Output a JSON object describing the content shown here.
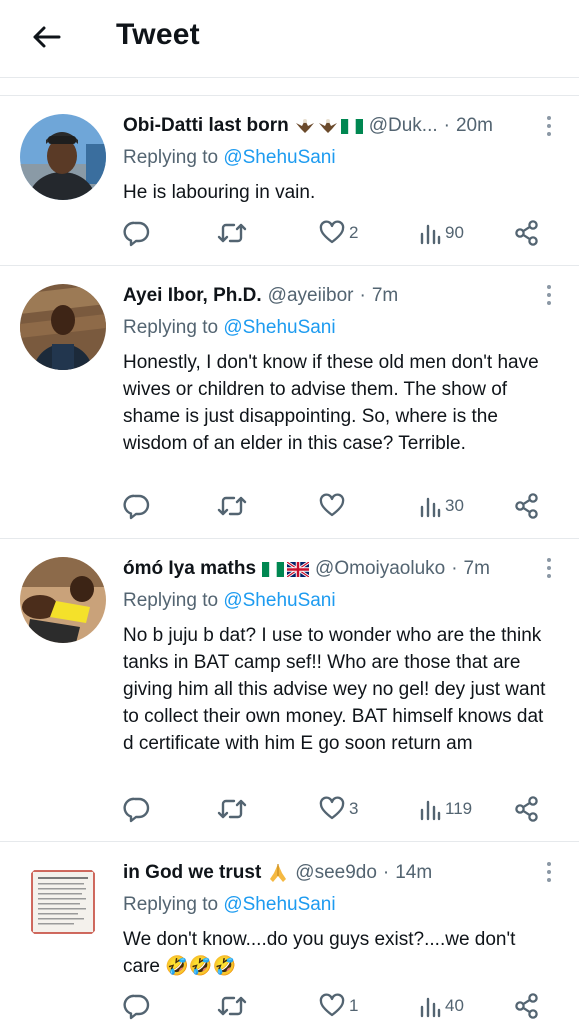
{
  "header": {
    "title": "Tweet"
  },
  "colors": {
    "accent": "#1d9bf0",
    "secondary_text": "#536471",
    "divider": "#e6e9ec"
  },
  "tweets": [
    {
      "name": "Obi-Datti last born",
      "flags": [
        "eagle-emoji",
        "eagle-emoji",
        "nigeria-flag"
      ],
      "handle": "@Duk...",
      "time": "20m",
      "replying_label": "Replying to",
      "replying_to": "@ShehuSani",
      "text": "He is labouring in vain.",
      "likes": "2",
      "views": "90",
      "retweets": "",
      "replies": ""
    },
    {
      "name": "Ayei Ibor, Ph.D.",
      "flags": [],
      "handle": "@ayeiibor",
      "time": "7m",
      "replying_label": "Replying to",
      "replying_to": "@ShehuSani",
      "text": "Honestly,  I don't know if these old men don't have wives or children to advise them. The show of shame is just disappointing.  So, where is the wisdom of an elder in this case? Terrible.",
      "likes": "",
      "views": "30",
      "retweets": "",
      "replies": ""
    },
    {
      "name": "ómó Iya maths",
      "flags": [
        "nigeria-flag",
        "uk-flag"
      ],
      "handle": "@Omoiyaoluko",
      "time": "7m",
      "replying_label": "Replying to",
      "replying_to": "@ShehuSani",
      "text": "No b juju b dat? I use to wonder who are the think tanks in BAT camp sef!! Who are those that are giving him all this advise wey no gel! dey just want to collect their own money. BAT himself knows dat d certificate with him E go soon return am",
      "likes": "3",
      "views": "119",
      "retweets": "",
      "replies": ""
    },
    {
      "name": "in God we trust",
      "flags": [
        "folded-hands-emoji"
      ],
      "handle": "@see9do",
      "time": "14m",
      "replying_label": "Replying to",
      "replying_to": "@ShehuSani",
      "text": "We don't know....do you guys exist?....we don't care 🤣🤣🤣",
      "likes": "1",
      "views": "40",
      "retweets": "",
      "replies": ""
    }
  ]
}
